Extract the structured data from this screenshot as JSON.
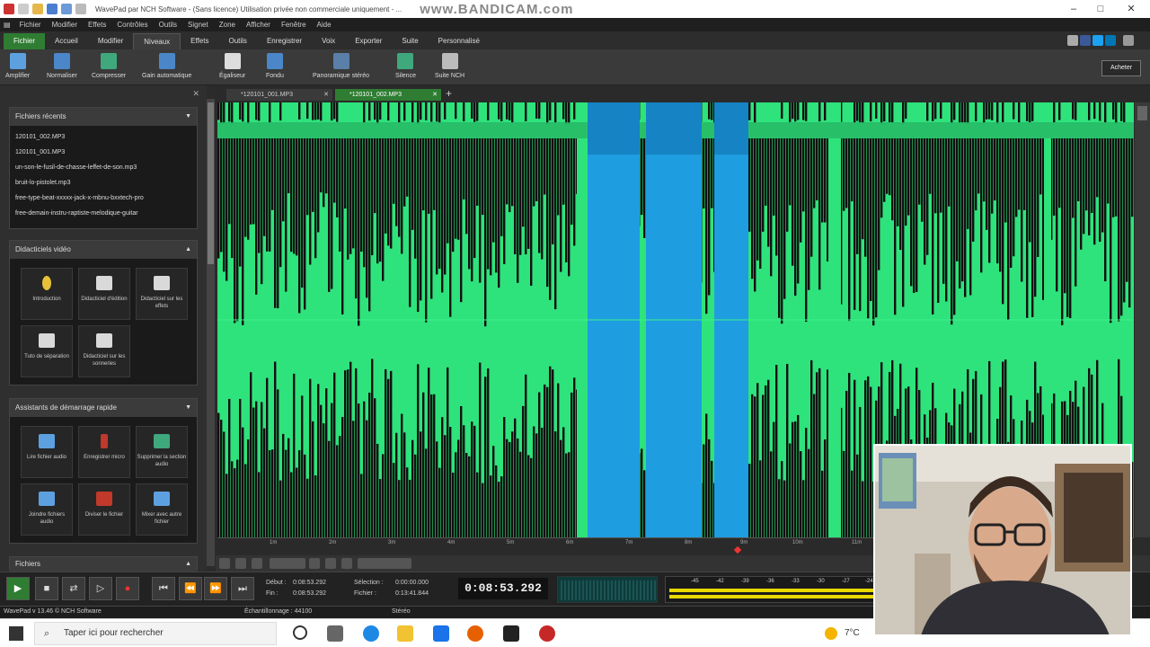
{
  "titlebar": {
    "title": "WavePad par NCH Software - (Sans licence) Utilisation privée non commerciale uniquement - ...",
    "watermark": "www.BANDICAM.com"
  },
  "menu": [
    "Fichier",
    "Modifier",
    "Effets",
    "Contrôles",
    "Outils",
    "Signet",
    "Zone",
    "Afficher",
    "Fenêtre",
    "Aide"
  ],
  "ribbon_tabs": [
    "Fichier",
    "Accueil",
    "Modifier",
    "Niveaux",
    "Effets",
    "Outils",
    "Enregistrer",
    "Voix",
    "Exporter",
    "Suite",
    "Personnalisé"
  ],
  "active_tab": "Niveaux",
  "toolbar": {
    "tools": [
      "Amplifier",
      "Normaliser",
      "Compresser",
      "Gain automatique",
      "Égaliseur",
      "Fondu",
      "Panoramique stéréo",
      "Silence",
      "Suite NCH"
    ],
    "buy_label": "Acheter"
  },
  "recent": {
    "title": "Fichiers récents",
    "items": [
      "120101_002.MP3",
      "120101_001.MP3",
      "un-son-le-fusil-de-chasse-leffet-de-son.mp3",
      "bruit-lo-pistolet.mp3",
      "free-type-beat-xxxxx-jack-x-mbnu-bxxtech-pro",
      "free-demain-instru-raptiste-melodique-guitar"
    ]
  },
  "tutorials": {
    "title": "Didacticiels vidéo",
    "items": [
      "Introduction",
      "Didacticiel d'édition",
      "Didacticiel sur les effets",
      "Tuto de séparation",
      "Didacticiel sur les sonneries"
    ]
  },
  "assistants": {
    "title": "Assistants de démarrage rapide",
    "items": [
      "Lire fichier audio",
      "Enregistrer micro",
      "Supprimer la section audio",
      "Joindre fichiers audio",
      "Diviser le fichier",
      "Mixer avec autre fichier"
    ]
  },
  "files_panel": {
    "title": "Fichiers"
  },
  "file_tabs": [
    "*120101_001.MP3",
    "*120101_002.MP3"
  ],
  "active_file_tab": "*120101_002.MP3",
  "timeline_ticks": [
    "1m",
    "2m",
    "3m",
    "4m",
    "5m",
    "6m",
    "7m",
    "8m",
    "9m",
    "10m",
    "11m"
  ],
  "transport": {
    "debut_label": "Début :",
    "debut_value": "0:08:53.292",
    "fin_label": "Fin :",
    "fin_value": "0:08:53.292",
    "selection_label": "Sélection :",
    "selection_value": "0:00:00.000",
    "fichier_label": "Fichier :",
    "fichier_value": "0:13:41.844",
    "current_time": "0:08:53.292",
    "meter_ticks": [
      "-45",
      "-42",
      "-39",
      "-36",
      "-33",
      "-30",
      "-27",
      "-24"
    ]
  },
  "status": {
    "version": "WavePad v 13.46 © NCH Software",
    "sample": "Échantillonnage : 44100",
    "channels": "Stéréo"
  },
  "taskbar": {
    "search_placeholder": "Taper ici pour rechercher",
    "weather": "7°C"
  },
  "colors": {
    "wave": "#2ee37c",
    "selection": "#1e9de0",
    "file_tab": "#2e7d32"
  }
}
